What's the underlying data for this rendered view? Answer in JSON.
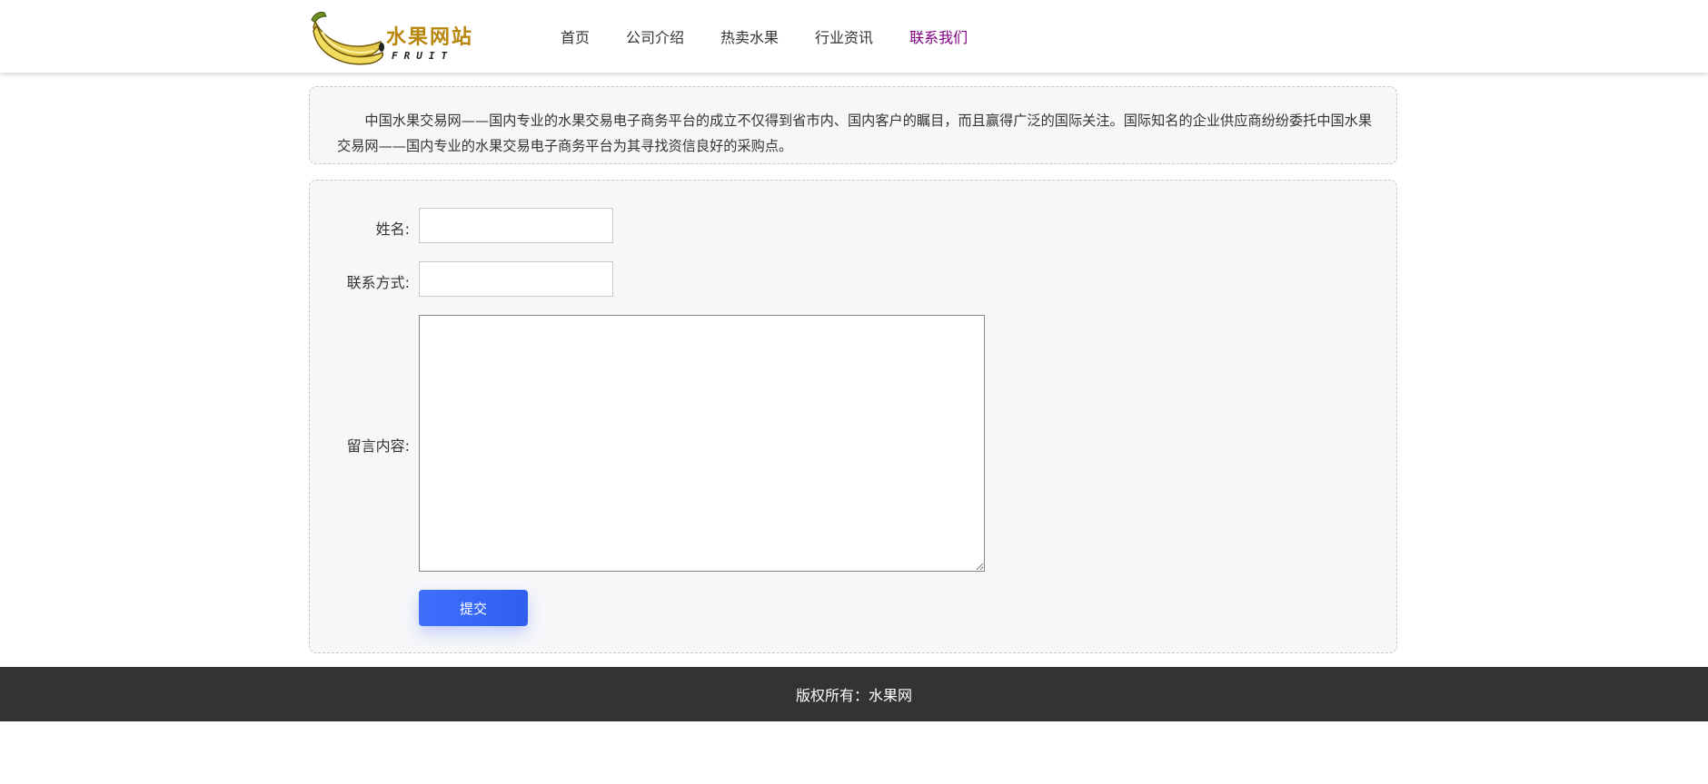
{
  "header": {
    "logo_text": "水果网站",
    "logo_sub": "FRUIT",
    "nav": [
      {
        "label": "首页",
        "active": false
      },
      {
        "label": "公司介绍",
        "active": false
      },
      {
        "label": "热卖水果",
        "active": false
      },
      {
        "label": "行业资讯",
        "active": false
      },
      {
        "label": "联系我们",
        "active": true
      }
    ]
  },
  "intro": {
    "text": "中国水果交易网——国内专业的水果交易电子商务平台的成立不仅得到省市内、国内客户的瞩目，而且赢得广泛的国际关注。国际知名的企业供应商纷纷委托中国水果交易网——国内专业的水果交易电子商务平台为其寻找资信良好的采购点。"
  },
  "form": {
    "name_label": "姓名:",
    "name_value": "",
    "contact_label": "联系方式:",
    "contact_value": "",
    "message_label": "留言内容:",
    "message_value": "",
    "submit_label": "提交"
  },
  "footer": {
    "text": "版权所有：水果网"
  },
  "colors": {
    "nav_active": "#800080",
    "submit_bg": "#3f6ffb",
    "footer_bg": "#333333",
    "logo_gold": "#b8860b"
  }
}
